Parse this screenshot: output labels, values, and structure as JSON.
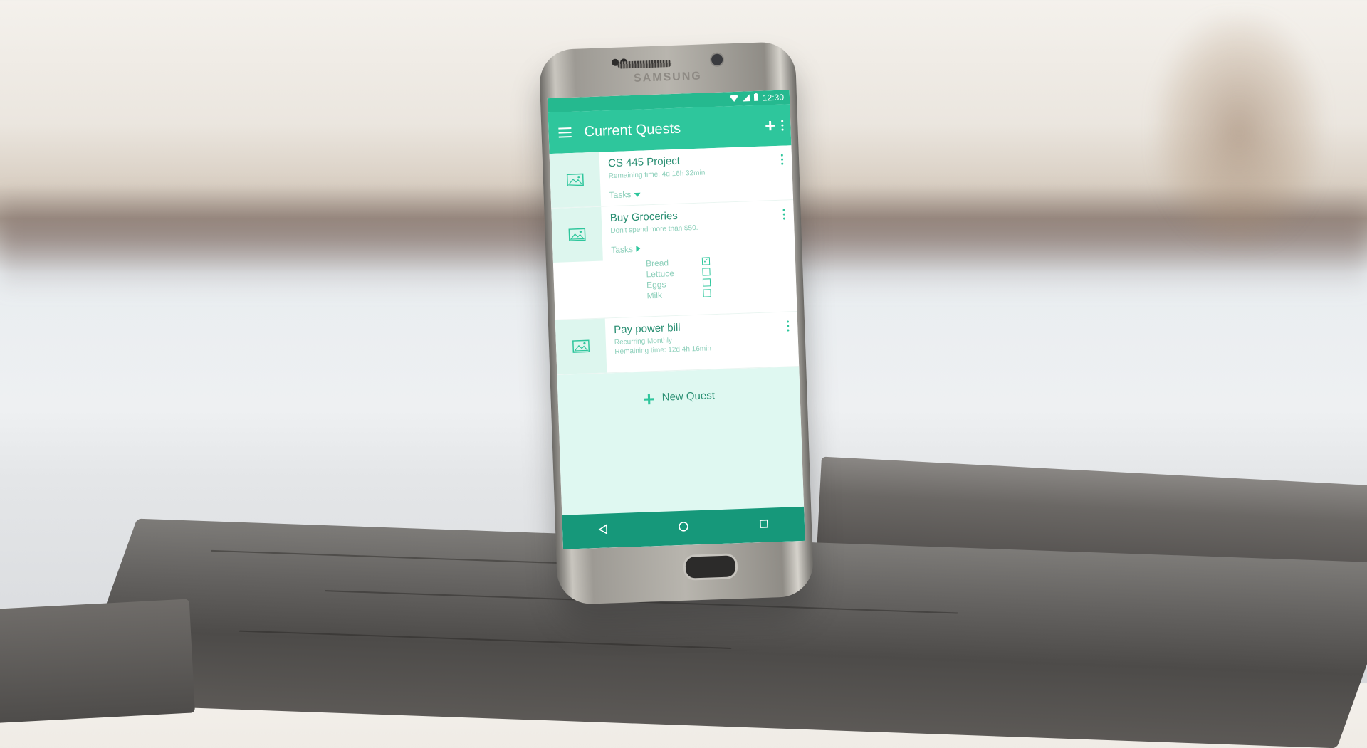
{
  "device": {
    "brand": "SAMSUNG"
  },
  "status_bar": {
    "time": "12:30"
  },
  "app_bar": {
    "title": "Current Quests"
  },
  "quests": [
    {
      "title": "CS 445 Project",
      "subtitle": "Remaining time: 4d 16h 32min",
      "tasks_label": "Tasks"
    },
    {
      "title": "Buy Groceries",
      "subtitle": "Don't spend more than $50.",
      "tasks_label": "Tasks",
      "task_items": [
        {
          "label": "Bread",
          "checked": true
        },
        {
          "label": "Lettuce",
          "checked": false
        },
        {
          "label": "Eggs",
          "checked": false
        },
        {
          "label": "Milk",
          "checked": false
        }
      ]
    },
    {
      "title": "Pay power bill",
      "subtitle": "Recurring Monthly",
      "subtitle2": "Remaining time: 12d 4h 16min"
    }
  ],
  "new_quest": {
    "label": "New Quest"
  },
  "icons": {
    "menu": "menu-icon",
    "add": "plus-icon",
    "more": "more-vert-icon",
    "image": "image-placeholder-icon",
    "back": "back-triangle-icon",
    "home": "home-circle-icon",
    "recents": "recents-square-icon"
  },
  "colors": {
    "primary": "#2ec69c",
    "primary_dark": "#16987a",
    "light_bg": "#dff8f1",
    "text": "#2a8f73",
    "muted": "#8ccfba"
  }
}
